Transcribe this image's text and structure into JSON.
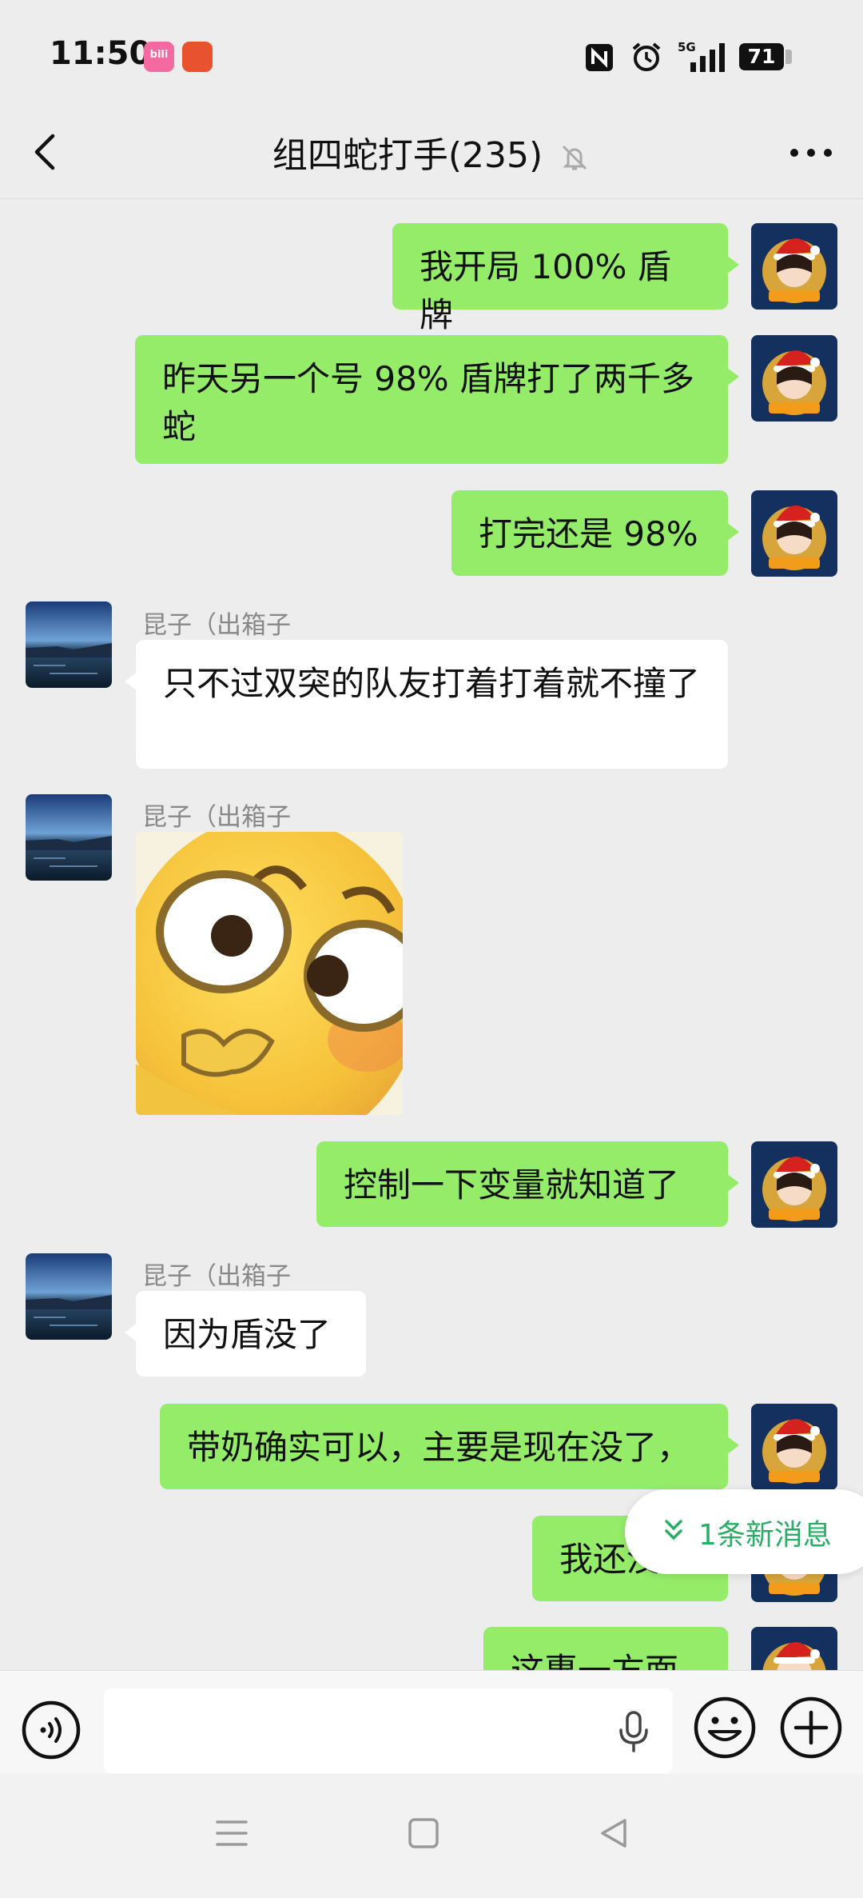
{
  "status_bar": {
    "time": "11:50",
    "app_icons": [
      "bilibili-icon",
      "notification-app-icon"
    ],
    "network": "5G",
    "battery": "71",
    "icons": [
      "nfc-icon",
      "alarm-icon",
      "signal-5g-icon",
      "battery-icon"
    ]
  },
  "header": {
    "title": "组四蛇打手(235)",
    "back_icon": "chevron-left-icon",
    "mute_icon": "bell-off-icon",
    "more_icon": "more-dots-icon"
  },
  "messages": [
    {
      "side": "out",
      "text": "我开局 100% 盾牌"
    },
    {
      "side": "out",
      "text": "昨天另一个号 98% 盾牌打了两千多蛇"
    },
    {
      "side": "out",
      "text": "打完还是 98%"
    },
    {
      "side": "in",
      "sender": "昆子（出箱子",
      "text": "只不过双突的队友打着打着就不撞了"
    },
    {
      "side": "in",
      "sender": "昆子（出箱子",
      "sticker": "yellow-face-sticker"
    },
    {
      "side": "out",
      "text": "控制一下变量就知道了"
    },
    {
      "side": "in",
      "sender": "昆子（出箱子",
      "text": "因为盾没了"
    },
    {
      "side": "out",
      "text": "带奶确实可以，主要是现在没了，"
    },
    {
      "side": "out",
      "text": "我还没有"
    },
    {
      "side": "out",
      "text": "这惠一方面"
    }
  ],
  "new_message_pill": {
    "label": "1条新消息",
    "icon": "double-chevron-down-icon",
    "accent": "#2aae67"
  },
  "input_bar": {
    "voice_icon": "voice-mode-icon",
    "mic_icon": "microphone-icon",
    "emoji_icon": "emoji-icon",
    "plus_icon": "plus-circle-icon",
    "value": "",
    "placeholder": ""
  },
  "nav_bar": {
    "icons": [
      "menu-icon",
      "home-square-icon",
      "back-triangle-icon"
    ]
  },
  "colors": {
    "bubble_out": "#95ec69",
    "bubble_in": "#ffffff",
    "background": "#ededed"
  }
}
